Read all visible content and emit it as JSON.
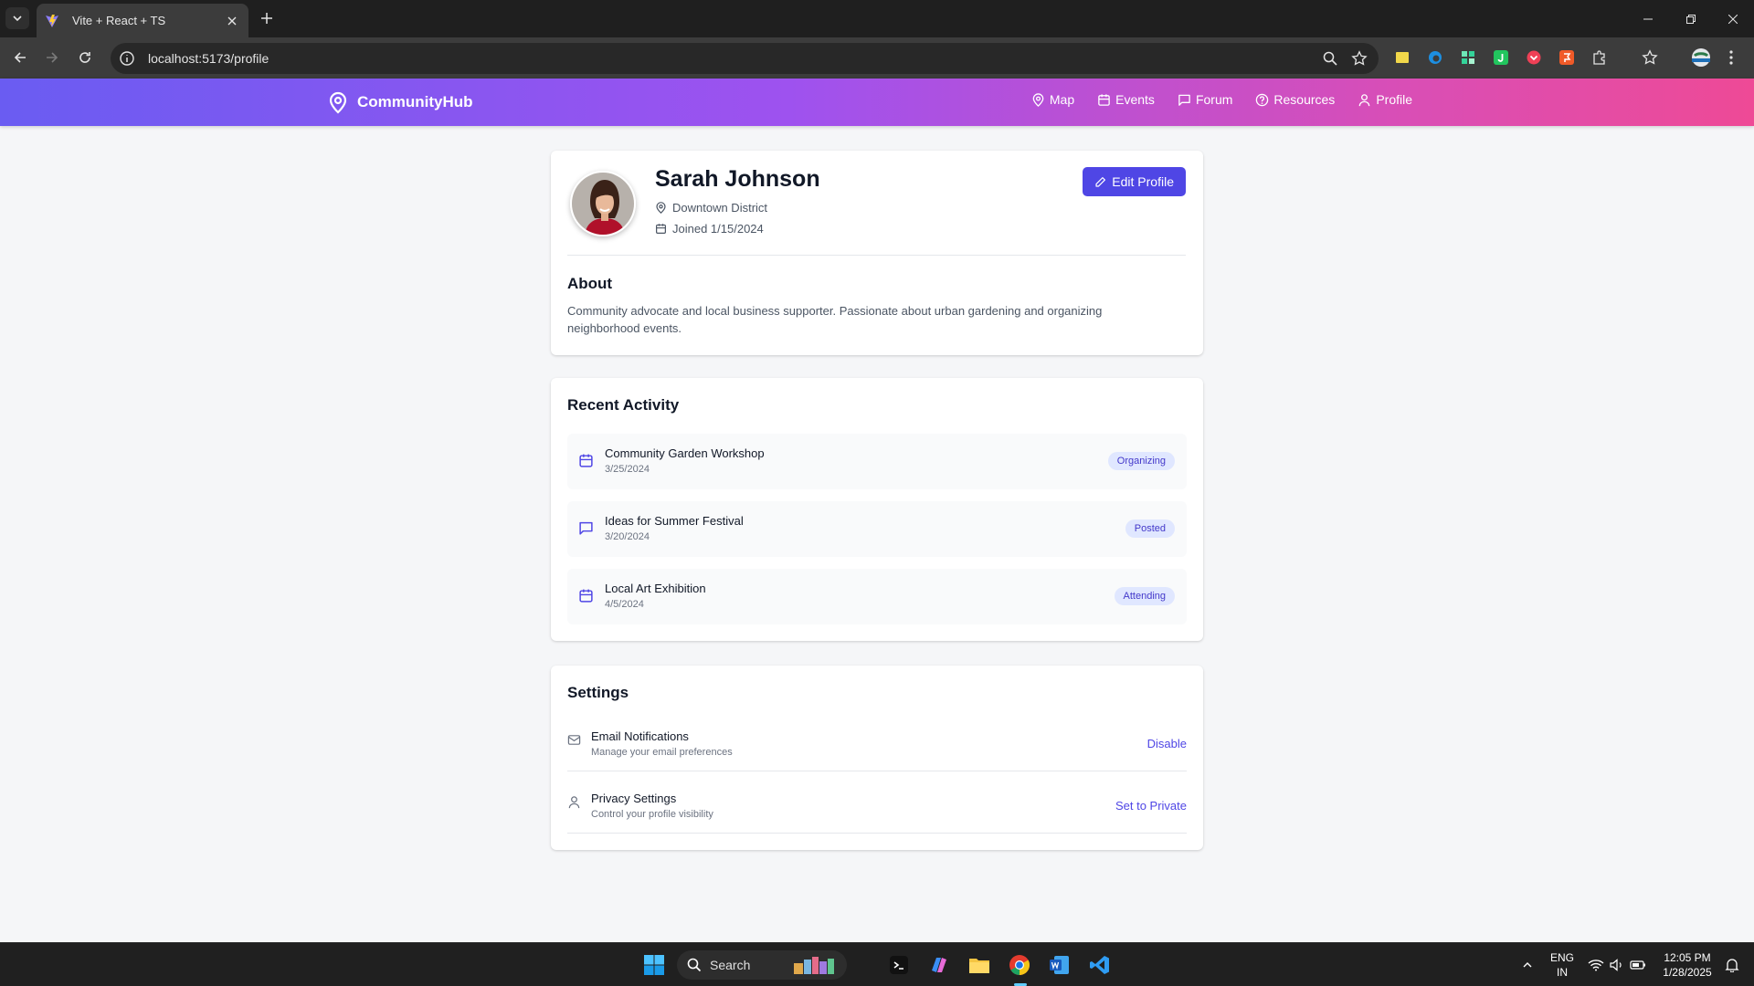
{
  "browser": {
    "tab_title": "Vite + React + TS",
    "url": "localhost:5173/profile"
  },
  "app": {
    "brand": "CommunityHub",
    "nav": [
      {
        "label": "Map",
        "icon": "map-pin-icon"
      },
      {
        "label": "Events",
        "icon": "calendar-icon"
      },
      {
        "label": "Forum",
        "icon": "message-square-icon"
      },
      {
        "label": "Resources",
        "icon": "help-circle-icon"
      },
      {
        "label": "Profile",
        "icon": "user-icon"
      }
    ],
    "accent": "#4f46e5"
  },
  "profile": {
    "name": "Sarah Johnson",
    "location": "Downtown District",
    "joined": "Joined 1/15/2024",
    "edit_label": "Edit Profile",
    "about_heading": "About",
    "about_text": "Community advocate and local business supporter. Passionate about urban gardening and organizing neighborhood events."
  },
  "activity": {
    "heading": "Recent Activity",
    "items": [
      {
        "title": "Community Garden Workshop",
        "date": "3/25/2024",
        "badge": "Organizing",
        "icon": "calendar-icon"
      },
      {
        "title": "Ideas for Summer Festival",
        "date": "3/20/2024",
        "badge": "Posted",
        "icon": "message-square-icon"
      },
      {
        "title": "Local Art Exhibition",
        "date": "4/5/2024",
        "badge": "Attending",
        "icon": "calendar-icon"
      }
    ]
  },
  "settings": {
    "heading": "Settings",
    "items": [
      {
        "title": "Email Notifications",
        "desc": "Manage your email preferences",
        "action": "Disable",
        "icon": "mail-icon"
      },
      {
        "title": "Privacy Settings",
        "desc": "Control your profile visibility",
        "action": "Set to Private",
        "icon": "user-icon"
      }
    ]
  },
  "taskbar": {
    "search_label": "Search",
    "lang_top": "ENG",
    "lang_bottom": "IN",
    "time": "12:05 PM",
    "date": "1/28/2025"
  }
}
